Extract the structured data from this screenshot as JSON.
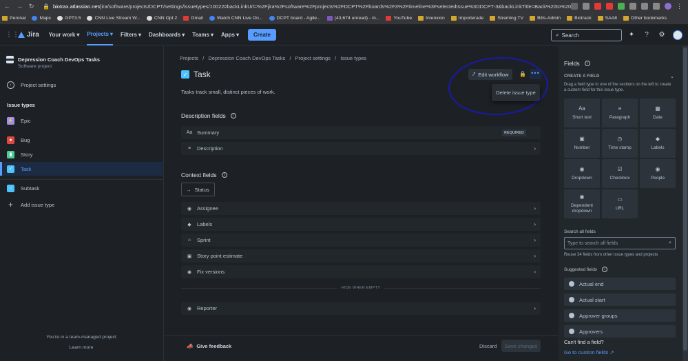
{
  "browser": {
    "url_host": "biotrax.atlassian.net",
    "url_rest": "/jira/software/projects/DCPT/settings/issuetypes/10022#backLinkUrl=%2Fjira%2Fsoftware%2Fprojects%2FDCPT%2Fboards%2F3%2Ftimeline%3FselectedIssue%3DDCPT-3&backLinkTitle=Back%20to%20DCPT-3",
    "bookmarks": [
      "Peronal",
      "Maps",
      "GPT3.5",
      "CNN Live Stream W...",
      "CNN Opt 2",
      "Gmail",
      "Watch CNN Live On...",
      "DCPT board - Agile...",
      "(43,674 unread) - m...",
      "YouTube",
      "Intenxion",
      "Importerade",
      "Streming TV",
      "Bills-Admin",
      "Biotrack",
      "SAA8"
    ],
    "other_bookmarks": "Other bookmarks"
  },
  "topnav": {
    "app": "Jira",
    "items": [
      "Your work",
      "Projects",
      "Filters",
      "Dashboards",
      "Teams",
      "Apps"
    ],
    "create": "Create",
    "search_placeholder": "Search"
  },
  "sidebar": {
    "project_name": "Depression Coach DevOps Tasks",
    "project_type": "Software project",
    "project_settings": "Project settings",
    "issue_types_heading": "Issue types",
    "types": [
      "Epic",
      "Bug",
      "Story",
      "Task",
      "Subtask"
    ],
    "add_issue_type": "Add issue type",
    "footer_line1": "You're in a team-managed project",
    "footer_line2": "Learn more"
  },
  "main": {
    "breadcrumbs": [
      "Projects",
      "/",
      "Depression Coach DevOps Tasks",
      "/",
      "Project settings",
      "/",
      "Issue types"
    ],
    "title": "Task",
    "description": "Tasks track small, distinct pieces of work.",
    "edit_workflow": "Edit workflow",
    "more_menu_item": "Delete issue type",
    "description_fields_heading": "Description fields",
    "description_fields": [
      {
        "label": "Summary",
        "badge": "REQUIRED"
      },
      {
        "label": "Description"
      }
    ],
    "context_fields_heading": "Context fields",
    "status_label": "Status",
    "context_fields": [
      "Assignee",
      "Labels",
      "Sprint",
      "Story point estimate",
      "Fix versions"
    ],
    "hide_when_empty": "HIDE WHEN EMPTY",
    "hidden_fields": [
      "Reporter"
    ],
    "give_feedback": "Give feedback",
    "discard": "Discard",
    "save_changes": "Save changes"
  },
  "fields_panel": {
    "heading": "Fields",
    "create_field": "CREATE A FIELD",
    "create_help": "Drag a field type to one of the sections on the left to create a custom field for this issue type.",
    "types": [
      "Short text",
      "Paragraph",
      "Date",
      "Number",
      "Time stamp",
      "Labels",
      "Dropdown",
      "Checkbox",
      "People",
      "Dependent dropdown",
      "URL"
    ],
    "search_label": "Search all fields",
    "search_placeholder": "Type to search all fields",
    "reuse_text": "Reuse 34 fields from other issue types and projects",
    "suggested_heading": "Suggested fields",
    "suggested": [
      "Actual end",
      "Actual start",
      "Approver groups",
      "Approvers"
    ],
    "cant_find": "Can't find a field?",
    "go_custom": "Go to custom fields"
  },
  "colors": {
    "accent": "#579dff",
    "bg": "#1d2125",
    "panel": "#22272b",
    "annotation": "#1a1aa8"
  }
}
